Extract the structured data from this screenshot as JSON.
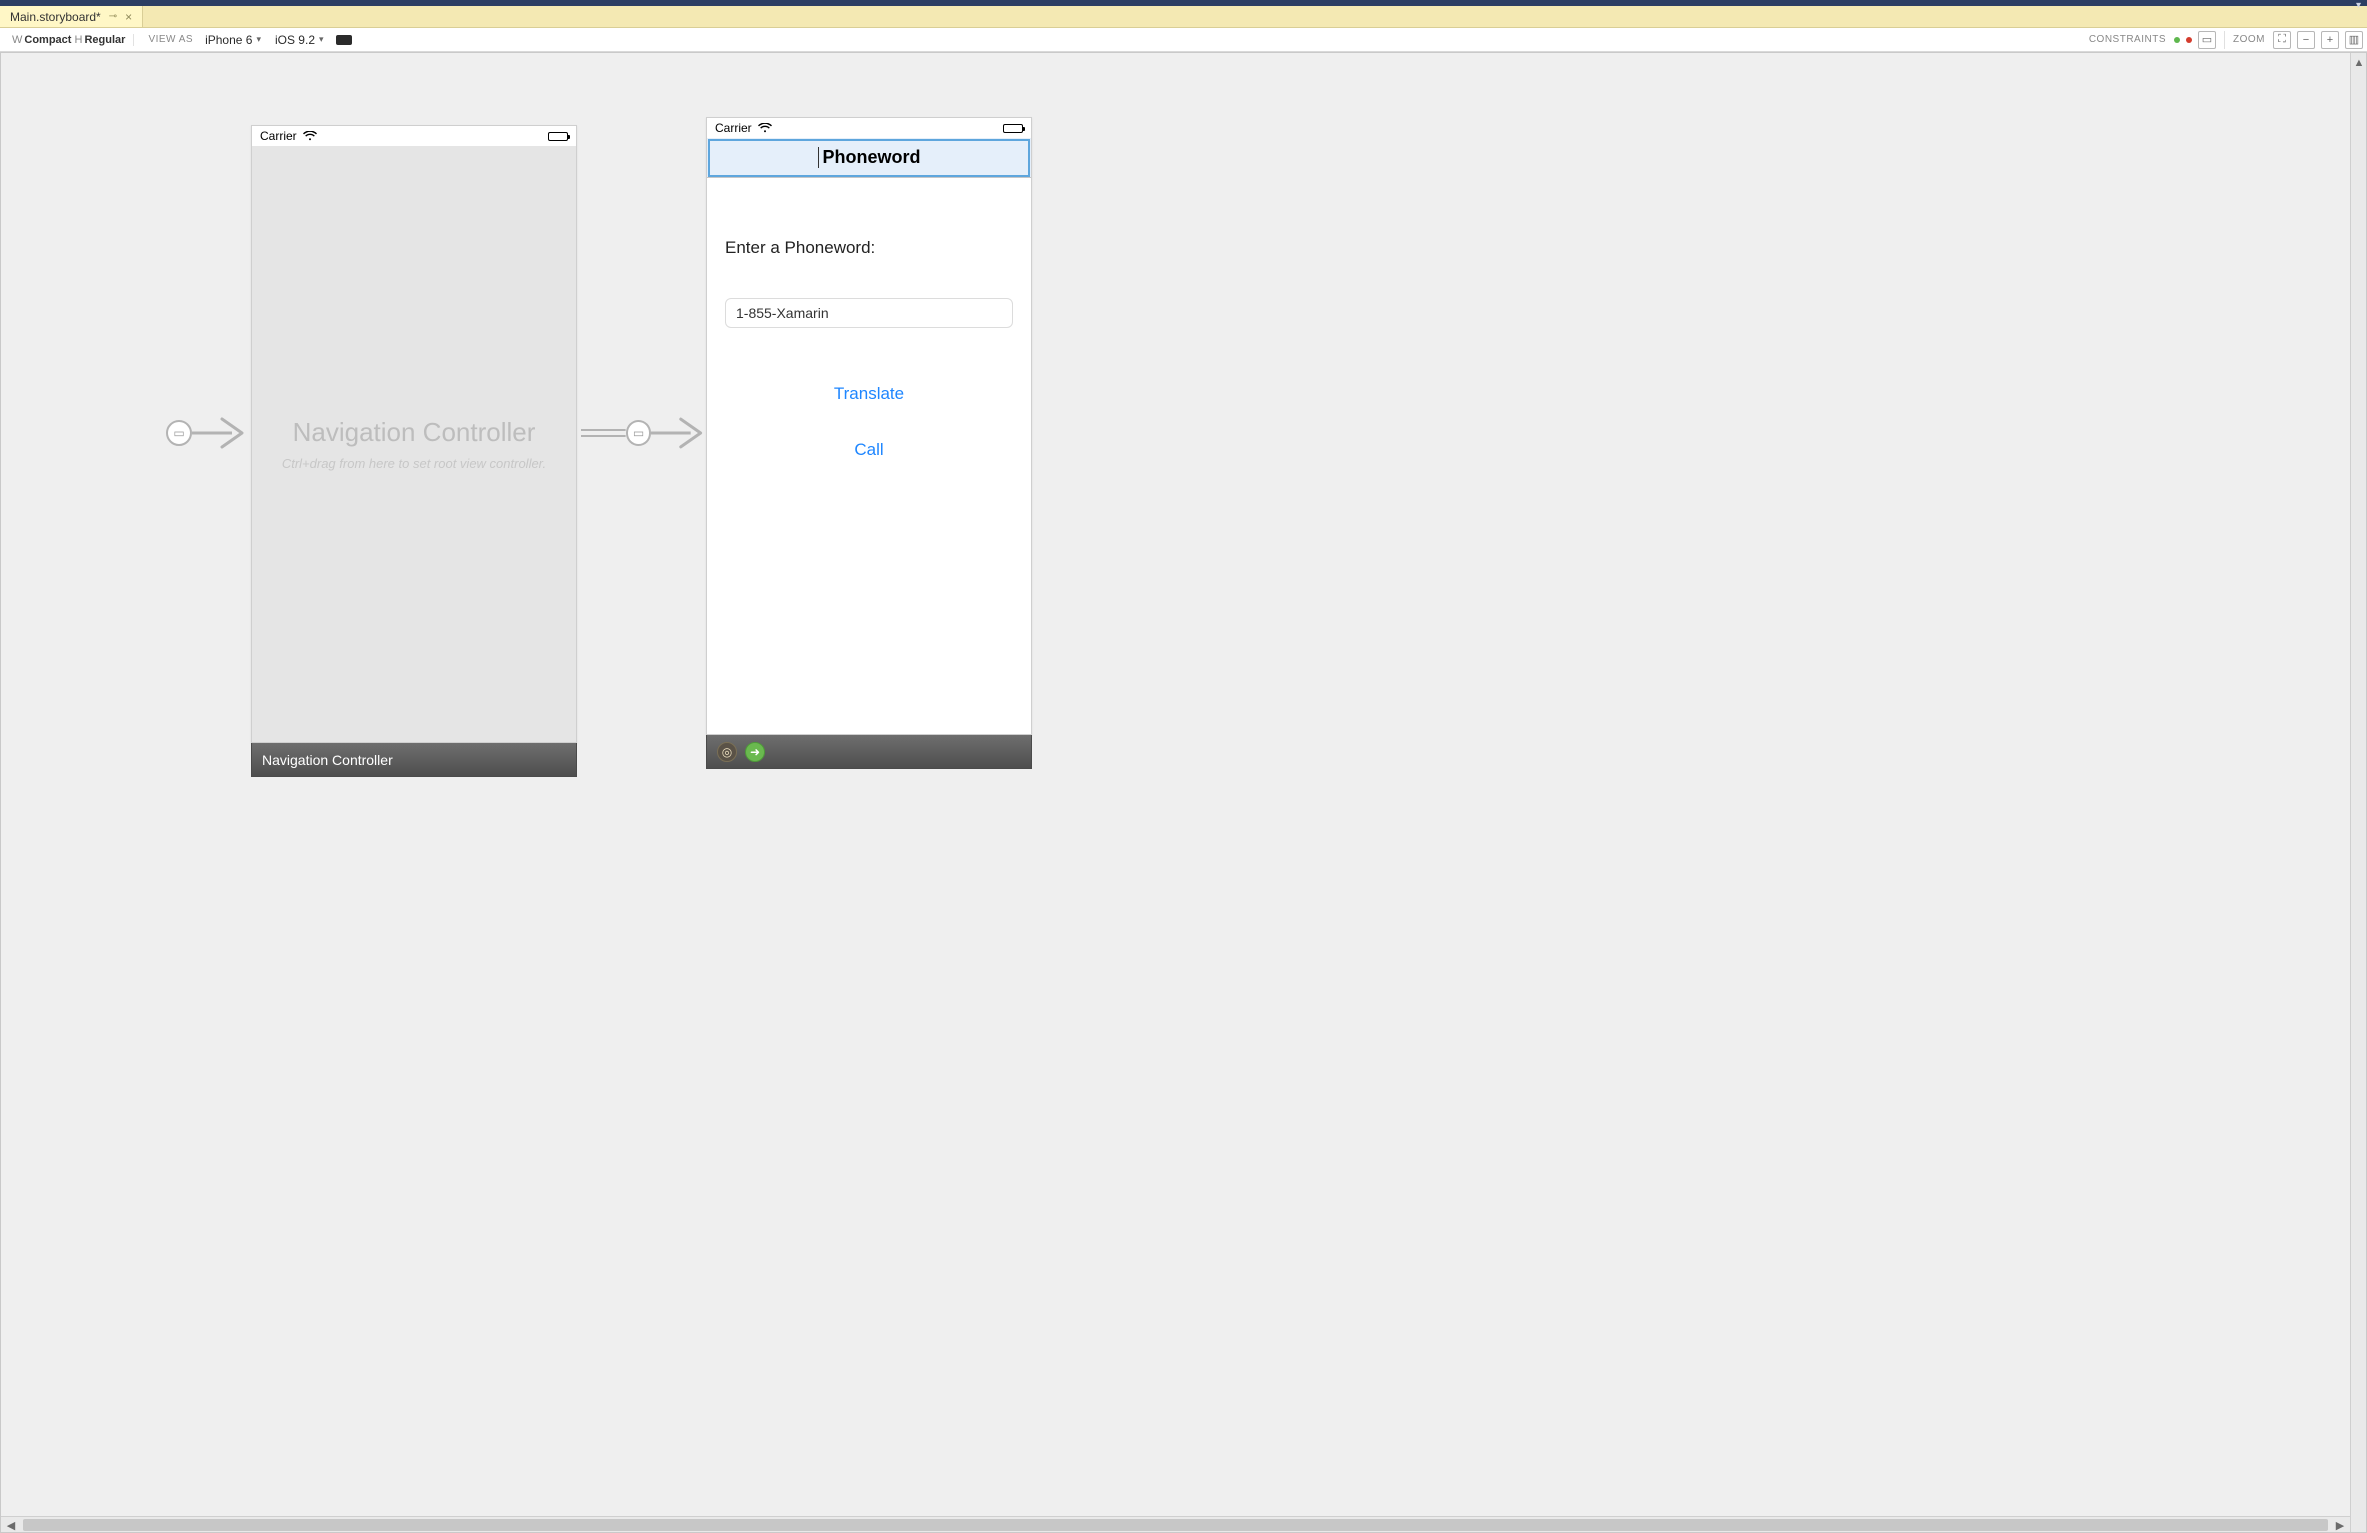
{
  "tab": {
    "title": "Main.storyboard*",
    "pin_glyph": "⊸",
    "close_glyph": "×"
  },
  "toolbar": {
    "size_w_letter": "W",
    "size_w_value": "Compact",
    "size_h_letter": "H",
    "size_h_value": "Regular",
    "view_as_label": "VIEW AS",
    "device": "iPhone 6",
    "ios": "iOS 9.2",
    "constraints_label": "CONSTRAINTS",
    "zoom_label": "ZOOM"
  },
  "scene1": {
    "status_carrier": "Carrier",
    "body_title": "Navigation Controller",
    "body_sub": "Ctrl+drag from here to set root view controller.",
    "label": "Navigation Controller"
  },
  "scene2": {
    "status_carrier": "Carrier",
    "nav_title": "Phoneword",
    "prompt": "Enter a Phoneword:",
    "input_value": "1-855-Xamarin",
    "btn_translate": "Translate",
    "btn_call": "Call"
  }
}
